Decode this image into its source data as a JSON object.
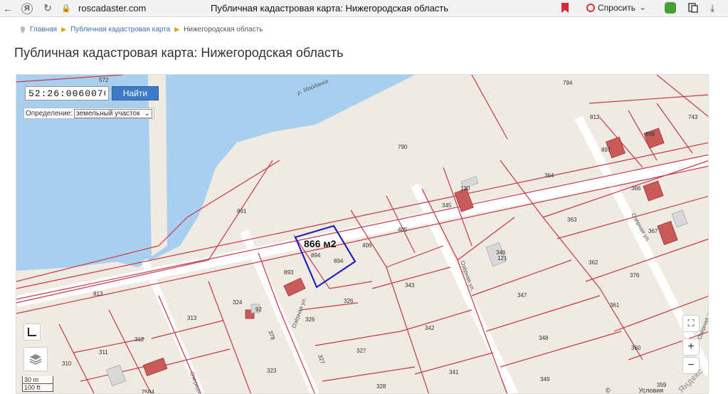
{
  "browser": {
    "url": "roscadaster.com",
    "tab_title": "Публичная кадастровая карта: Нижегородская область",
    "ask_label": "Спросить"
  },
  "breadcrumb": {
    "items": [
      "Главная",
      "Публичная кадастровая карта"
    ],
    "current": "Нижегородская область"
  },
  "page": {
    "title": "Публичная кадастровая карта: Нижегородская область"
  },
  "map": {
    "search_value": "52:26:0060070",
    "search_button": "Найти",
    "definition_label": "Определение:",
    "definition_value": "земельный участок",
    "area_label": "866 м2",
    "scale_metric": "30 m",
    "scale_imperial": "100 ft",
    "copyright": "© Яндекс",
    "terms": "Условия использования",
    "logo": "Яндекс",
    "parcels": [
      "572",
      "794",
      "813",
      "743",
      "898",
      "897",
      "790",
      "364",
      "366",
      "345",
      "120",
      "891",
      "367",
      "405",
      "406",
      "866 м2",
      "894",
      "894",
      "363",
      "346",
      "121",
      "893",
      "343",
      "362",
      "376",
      "813",
      "324",
      "92",
      "326",
      "326",
      "347",
      "361",
      "313",
      "312",
      "311",
      "310",
      "378",
      "327",
      "342",
      "348",
      "360",
      "327",
      "323",
      "341",
      "349",
      "328",
      "359",
      "2504"
    ],
    "streets": [
      "р. Майданка",
      "Озёрная ул.",
      "Озёрная ул.",
      "Озёрная ул.",
      "Озёрная ул.",
      "Озёрная ул."
    ]
  }
}
